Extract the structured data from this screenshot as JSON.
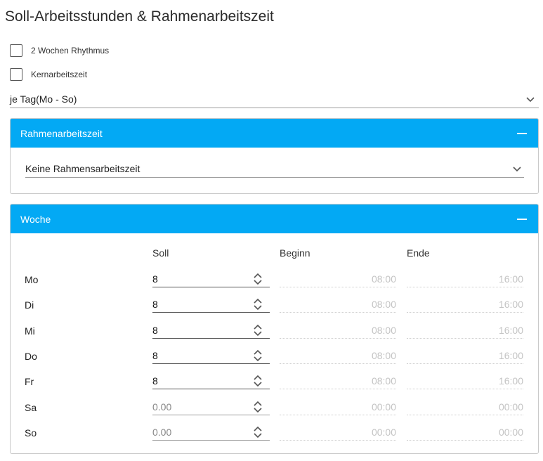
{
  "title": "Soll-Arbeitsstunden & Rahmenarbeitszeit",
  "checkboxes": [
    {
      "label": "2 Wochen Rhythmus",
      "checked": false
    },
    {
      "label": "Kernarbeitszeit",
      "checked": false
    }
  ],
  "mode_select": {
    "value": "je Tag(Mo - So)"
  },
  "rahmen_panel": {
    "title": "Rahmenarbeitszeit",
    "select_value": "Keine Rahmensarbeitszeit"
  },
  "woche_panel": {
    "title": "Woche",
    "columns": {
      "soll": "Soll",
      "beginn": "Beginn",
      "ende": "Ende"
    },
    "rows": [
      {
        "day": "Mo",
        "soll": "8",
        "beginn": "08:00",
        "ende": "16:00"
      },
      {
        "day": "Di",
        "soll": "8",
        "beginn": "08:00",
        "ende": "16:00"
      },
      {
        "day": "Mi",
        "soll": "8",
        "beginn": "08:00",
        "ende": "16:00"
      },
      {
        "day": "Do",
        "soll": "8",
        "beginn": "08:00",
        "ende": "16:00"
      },
      {
        "day": "Fr",
        "soll": "8",
        "beginn": "08:00",
        "ende": "16:00"
      },
      {
        "day": "Sa",
        "soll": "0.00",
        "beginn": "00:00",
        "ende": "00:00"
      },
      {
        "day": "So",
        "soll": "0.00",
        "beginn": "00:00",
        "ende": "00:00"
      }
    ]
  },
  "colors": {
    "accent": "#03a9f4"
  }
}
